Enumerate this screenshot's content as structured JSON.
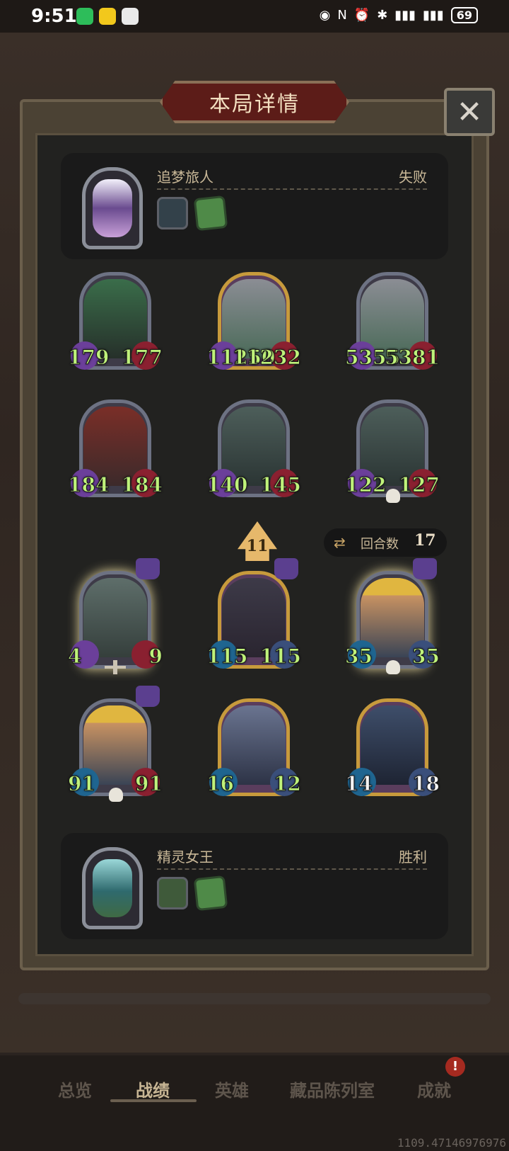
{
  "status_bar": {
    "time": "9:51",
    "battery": "69"
  },
  "dialog": {
    "title": "本局详情",
    "close_icon": "close-icon"
  },
  "top_player": {
    "name": "追梦旅人",
    "result": "失败"
  },
  "bottom_player": {
    "name": "精灵女王",
    "result": "胜利"
  },
  "opponent_board": [
    [
      {
        "atk": "179",
        "hp": "177",
        "style": "silver"
      },
      {
        "atk": "11250",
        "hp": "11232",
        "style": "gold"
      },
      {
        "atk": "5355",
        "hp": "5381",
        "style": "silver"
      }
    ],
    [
      {
        "atk": "184",
        "hp": "184",
        "style": "silver"
      },
      {
        "atk": "140",
        "hp": "145",
        "style": "silver"
      },
      {
        "atk": "122",
        "hp": "127",
        "style": "silver"
      }
    ]
  ],
  "player_board": [
    [
      {
        "atk": "4",
        "hp": "9",
        "style": "silver-glow"
      },
      {
        "atk": "115",
        "hp": "115",
        "style": "gold"
      },
      {
        "atk": "35",
        "hp": "35",
        "style": "silver-glow"
      }
    ],
    [
      {
        "atk": "91",
        "hp": "91",
        "style": "silver"
      },
      {
        "atk": "16",
        "hp": "12",
        "style": "gold"
      },
      {
        "atk": "14",
        "hp": "18",
        "style": "gold"
      }
    ]
  ],
  "turn_indicator": "11",
  "round": {
    "label": "回合数",
    "value": "17"
  },
  "nav": {
    "items": [
      "总览",
      "战绩",
      "英雄",
      "藏品陈列室",
      "成就"
    ],
    "active_index": 1,
    "notification": "!"
  },
  "footer_coords": "1109.47146976976",
  "colors": {
    "stat_text": "#bff27a",
    "accent_gold": "#c79a3c",
    "title_red": "#5c1c18"
  }
}
